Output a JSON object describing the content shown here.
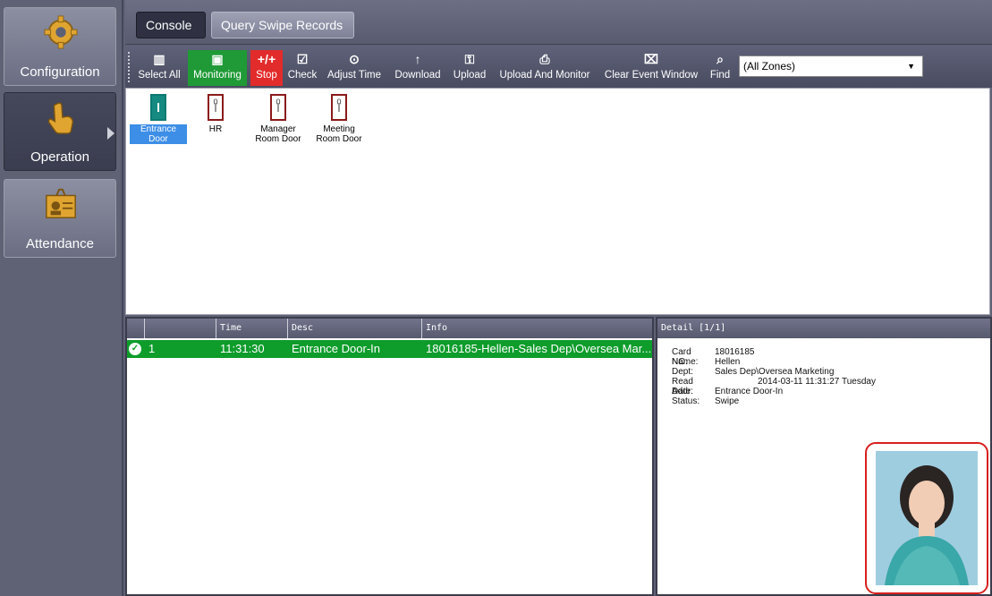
{
  "sidebar": {
    "items": [
      {
        "label": "Configuration",
        "icon": "gear-icon"
      },
      {
        "label": "Operation",
        "icon": "hand-pointer-icon"
      },
      {
        "label": "Attendance",
        "icon": "id-card-icon"
      }
    ]
  },
  "tabs": {
    "console": "Console",
    "query": "Query Swipe Records"
  },
  "toolbar": {
    "select_all": "Select All",
    "monitoring": "Monitoring",
    "stop": "Stop",
    "check": "Check",
    "adjust_time": "Adjust Time",
    "download": "Download",
    "upload": "Upload",
    "upload_monitor": "Upload And Monitor",
    "clear_event": "Clear Event Window",
    "find": "Find",
    "zone_value": "(All Zones)"
  },
  "doors": [
    {
      "label": "Entrance Door",
      "num": ""
    },
    {
      "label": "HR",
      "num": "0"
    },
    {
      "label": "Manager Room Door",
      "num": "0"
    },
    {
      "label": "Meeting Room Door",
      "num": "0"
    }
  ],
  "events": {
    "columns": [
      "",
      "",
      "Time",
      "Desc",
      "Info"
    ],
    "row": {
      "index": "1",
      "time": "11:31:30",
      "desc": "Entrance Door-In",
      "info": "18016185-Hellen-Sales Dep\\Oversea Mar..."
    }
  },
  "detail": {
    "title": "Detail [1/1]",
    "card_no_key": "Card NO:",
    "card_no": "18016185",
    "name_key": "Name:",
    "name": "Hellen",
    "dept_key": "Dept:",
    "dept": "Sales Dep\\Oversea Marketing",
    "read_date_key": "Read Date:",
    "read_date": "2014-03-11 11:31:27 Tuesday",
    "addr_key": "Addr:",
    "addr": "Entrance Door-In",
    "status_key": "Status:",
    "status": "Swipe"
  },
  "colors": {
    "accent_green": "#0e9c2b",
    "stop_red": "#e22b2b",
    "highlight_red": "#d81f1f"
  }
}
